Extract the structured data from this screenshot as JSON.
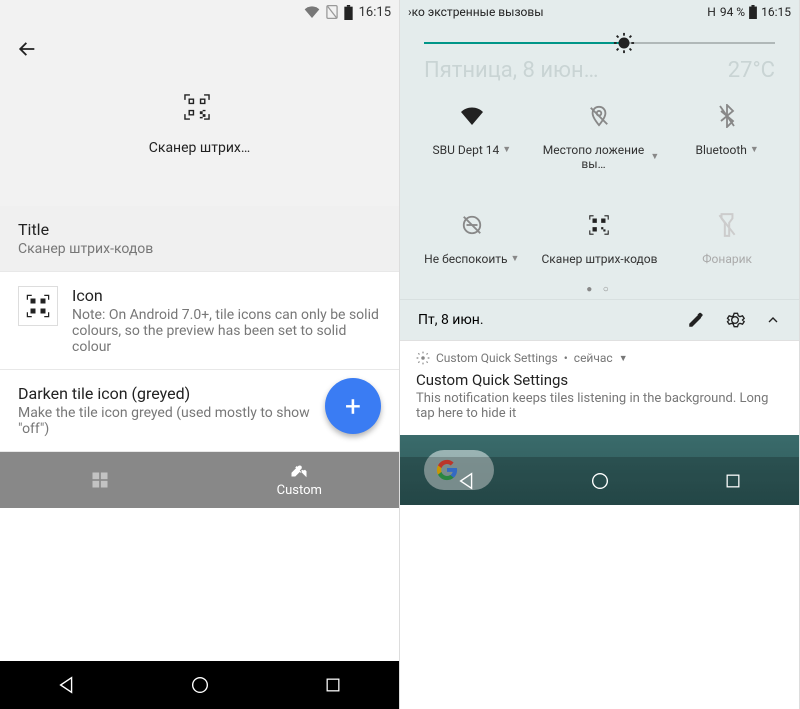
{
  "left": {
    "status": {
      "time": "16:15"
    },
    "preview_label": "Сканер штрих…",
    "title_label": "Title",
    "title_value": "Сканер штрих-кодов",
    "icon_label": "Icon",
    "icon_note": "Note: On Android 7.0+, tile icons can only be solid colours, so the preview has been set to solid colour",
    "darken_label": "Darken tile icon (greyed)",
    "darken_note": "Make the tile icon greyed (used mostly to show \"off\")",
    "tab_custom": "Custom"
  },
  "right": {
    "status": {
      "carrier": "›ко экстренные вызовы",
      "signal": "H",
      "battery": "94 %",
      "time": "16:15"
    },
    "brightness": {
      "percent": 57
    },
    "date_faded": "Пятница, 8 июн…",
    "weather_faded": "27°C",
    "tiles": [
      {
        "label": "SBU Dept 14",
        "expandable": true,
        "active": true,
        "icon": "wifi"
      },
      {
        "label": "Местопо ложение вы…",
        "expandable": true,
        "active": false,
        "icon": "location-off"
      },
      {
        "label": "Bluetooth",
        "expandable": true,
        "active": false,
        "icon": "bluetooth-off"
      },
      {
        "label": "Не беспокоить",
        "expandable": true,
        "active": false,
        "icon": "dnd-off"
      },
      {
        "label": "Сканер штрих-кодов",
        "expandable": false,
        "active": true,
        "icon": "qr"
      },
      {
        "label": "Фонарик",
        "expandable": false,
        "active": false,
        "icon": "flashlight-off"
      }
    ],
    "footer_date": "Пт, 8 июн.",
    "notif": {
      "app": "Custom Quick Settings",
      "when": "сейчас",
      "title": "Custom Quick Settings",
      "body": "This notification keeps tiles listening in the background. Long tap here to hide it"
    }
  }
}
